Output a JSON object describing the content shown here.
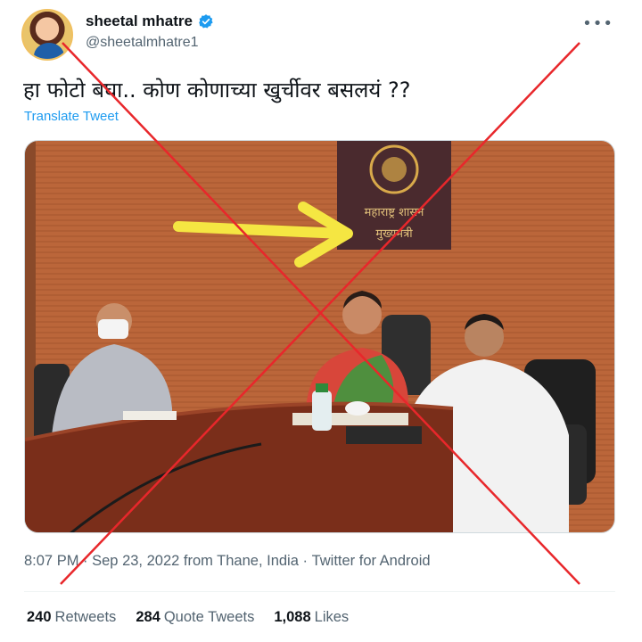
{
  "user": {
    "display_name": "sheetal mhatre",
    "handle": "@sheetalmhatre1",
    "verified": true
  },
  "menu_icon": "more-dots-icon",
  "tweet": {
    "text": "हा फोटो बघा.. कोण कोणाच्या खुर्चीवर बसलयं ??",
    "translate_label": "Translate Tweet"
  },
  "media": {
    "sign_line1": "महाराष्ट्र शासन",
    "sign_line2": "मुख्यमंत्री"
  },
  "meta": {
    "time": "8:07 PM",
    "separator1": " · ",
    "date_location": "Sep 23, 2022 from Thane, India",
    "separator2": " · ",
    "client": "Twitter for Android"
  },
  "stats": {
    "retweets_count": "240",
    "retweets_label": "Retweets",
    "quotes_count": "284",
    "quotes_label": "Quote Tweets",
    "likes_count": "1,088",
    "likes_label": "Likes"
  },
  "colors": {
    "verified_blue": "#1d9bf0",
    "cross_red": "#e8272b",
    "arrow_yellow": "#f5e642"
  }
}
